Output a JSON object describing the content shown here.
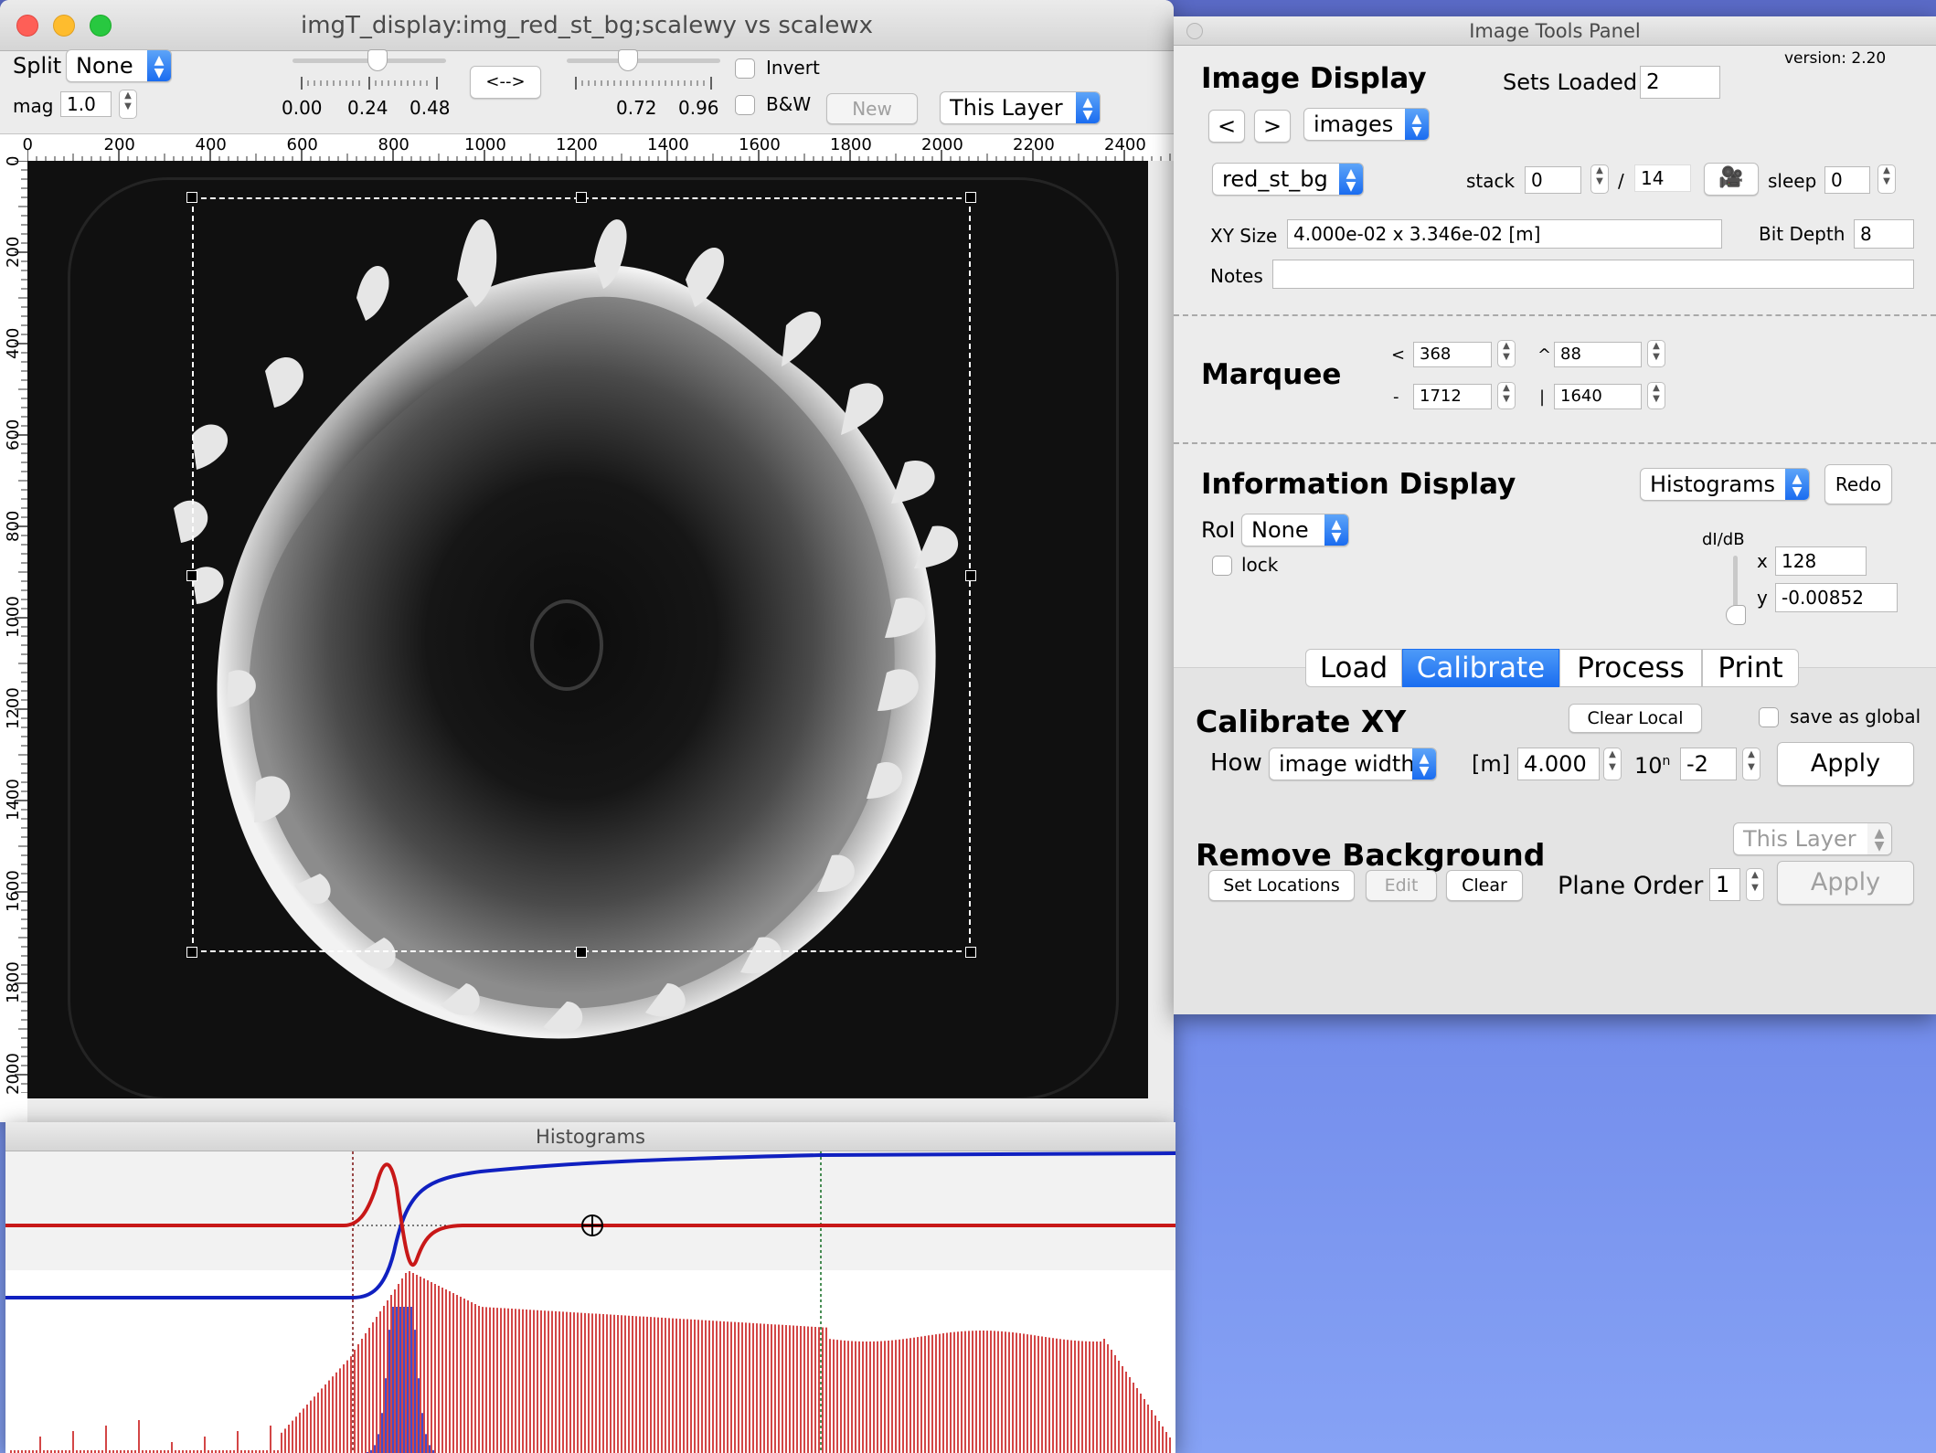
{
  "main_window": {
    "title": "imgT_display:img_red_st_bg;scalewy vs scalewx",
    "split_label": "Split",
    "split_value": "None",
    "mag_label": "mag",
    "mag_value": "1.0",
    "slider1_labels": [
      "0.00",
      "0.24",
      "0.48"
    ],
    "swap_button": "<-->",
    "slider2_labels": [
      "0.72",
      "0.96"
    ],
    "invert_label": "Invert",
    "bw_label": "B&W",
    "new_button": "New",
    "layer_value": "This Layer",
    "x_ticks": [
      "0",
      "200",
      "400",
      "600",
      "800",
      "1000",
      "1200",
      "1400",
      "1600",
      "1800",
      "2000",
      "2200",
      "2400"
    ],
    "y_ticks": [
      "0",
      "200",
      "400",
      "600",
      "800",
      "1000",
      "1200",
      "1400",
      "1600",
      "1800",
      "2000"
    ]
  },
  "histogram_window": {
    "title": "Histograms"
  },
  "panel": {
    "title": "Image Tools Panel",
    "version": "version: 2.20",
    "image_display": {
      "heading": "Image Display",
      "sets_loaded_label": "Sets Loaded",
      "sets_loaded_value": "2",
      "prev": "<",
      "next": ">",
      "source_value": "images",
      "image_value": "red_st_bg",
      "stack_label": "stack",
      "stack_value": "0",
      "stack_sep": "/",
      "stack_total": "14",
      "sleep_label": "sleep",
      "sleep_value": "0",
      "xy_label": "XY Size",
      "xy_value": "4.000e-02 x 3.346e-02 [m]",
      "bit_depth_label": "Bit Depth",
      "bit_depth_value": "8",
      "notes_label": "Notes",
      "notes_value": ""
    },
    "marquee": {
      "heading": "Marquee",
      "left_sym": "<",
      "left": "368",
      "top_sym": "^",
      "top": "88",
      "width_sym": "-",
      "width": "1712",
      "height_sym": "|",
      "height": "1640"
    },
    "info": {
      "heading": "Information Display",
      "mode_value": "Histograms",
      "redo": "Redo",
      "roi_label": "RoI",
      "roi_value": "None",
      "lock_label": "lock",
      "didb_label": "dI/dB",
      "x_label": "x",
      "x_value": "128",
      "y_label": "y",
      "y_value": "-0.00852"
    },
    "tabs": [
      "Load",
      "Calibrate",
      "Process",
      "Print"
    ],
    "selected_tab": "Calibrate",
    "calibrate": {
      "heading": "Calibrate XY",
      "clear_local": "Clear Local",
      "save_global": "save as global",
      "how_label": "How",
      "how_value": "image width",
      "unit_label": "[m]",
      "value": "4.000",
      "exp_base": "10",
      "exp_sup": "n",
      "exp_value": "-2",
      "apply": "Apply"
    },
    "background": {
      "heading": "Remove Background",
      "layer_value": "This Layer",
      "set_locations": "Set Locations",
      "edit": "Edit",
      "clear": "Clear",
      "plane_order_label": "Plane Order",
      "plane_order_value": "1",
      "apply": "Apply"
    }
  },
  "colors": {
    "accent": "#1b6ef0",
    "hist_red": "#c81818",
    "hist_blue": "#1020c0"
  }
}
